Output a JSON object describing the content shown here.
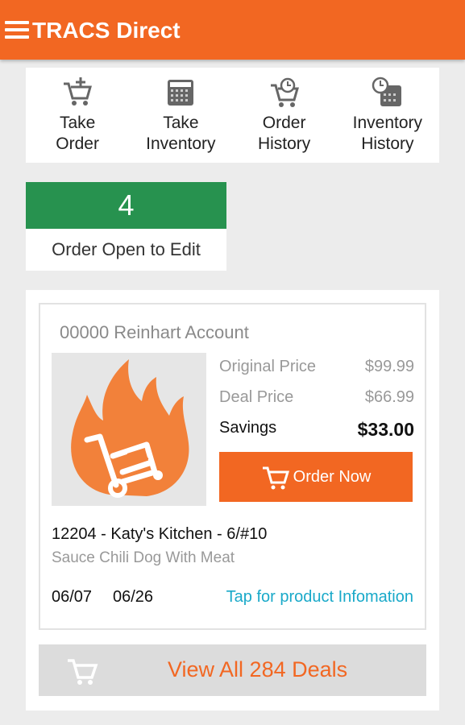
{
  "appbar": {
    "title": "TRACS Direct",
    "menu_icon": "hamburger-menu-icon",
    "background": "#f26722"
  },
  "quicknav": {
    "items": [
      {
        "label": "Take\nOrder",
        "icon": "cart-add-icon"
      },
      {
        "label": "Take\nInventory",
        "icon": "inventory-grid-icon"
      },
      {
        "label": "Order\nHistory",
        "icon": "cart-clock-icon"
      },
      {
        "label": "Inventory\nHistory",
        "icon": "inventory-clock-icon"
      }
    ]
  },
  "open_orders": {
    "count": "4",
    "label": "Order Open to Edit",
    "accent": "#27924f"
  },
  "deal": {
    "account": "00000 Reinhart Account",
    "image_icon": "hot-deals-flame-icon",
    "original_price_label": "Original Price",
    "original_price": "$99.99",
    "deal_price_label": "Deal Price",
    "deal_price": "$66.99",
    "savings_label": "Savings",
    "savings": "$33.00",
    "order_button": "Order Now",
    "product": "12204 - Katy's Kitchen - 6/#10",
    "description": "Sauce Chili Dog With Meat",
    "start_date": "06/07",
    "end_date": "06/26",
    "info_link": "Tap for product Infomation"
  },
  "view_all": {
    "label": "View All 284 Deals",
    "icon": "cart-icon"
  }
}
